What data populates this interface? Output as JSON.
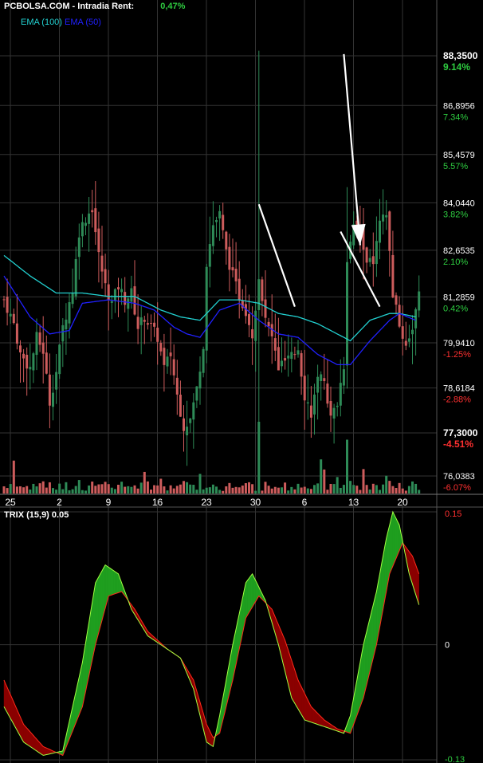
{
  "header": {
    "source": "PCBOLSA.COM",
    "mode": "Intradia",
    "rent_label": "Rent:",
    "rent_value": "0,47%"
  },
  "legend": {
    "ema100": {
      "label": "EMA (100)",
      "color": "#22d0d0"
    },
    "ema50": {
      "label": "EMA (50)",
      "color": "#2020ff"
    }
  },
  "colors": {
    "up": "#2e8b57",
    "down": "#cd5c5c",
    "pos_pct": "#2ecc40",
    "neg_pct": "#ff3030",
    "grid": "#333333"
  },
  "chart_data": [
    {
      "type": "candlestick",
      "ylim": [
        75.5,
        89.0
      ],
      "price_levels": [
        {
          "price": 88.35,
          "label": "88,3500",
          "pct": "9.14%",
          "positive": true,
          "bold": true
        },
        {
          "price": 86.8956,
          "label": "86,8956",
          "pct": "7.34%",
          "positive": true
        },
        {
          "price": 85.4579,
          "label": "85,4579",
          "pct": "5.57%",
          "positive": true
        },
        {
          "price": 84.044,
          "label": "84,0440",
          "pct": "3.82%",
          "positive": true
        },
        {
          "price": 82.6535,
          "label": "82,6535",
          "pct": "2.10%",
          "positive": true
        },
        {
          "price": 81.2859,
          "label": "81,2859",
          "pct": "0.42%",
          "positive": true
        },
        {
          "price": 79.941,
          "label": "79,9410",
          "pct": "-1.25%",
          "positive": false
        },
        {
          "price": 78.6184,
          "label": "78,6184",
          "pct": "-2.88%",
          "positive": false
        },
        {
          "price": 77.3,
          "label": "77,3000",
          "pct": "-4.51%",
          "positive": false,
          "bold": true
        },
        {
          "price": 76.0383,
          "label": "76,0383",
          "pct": "-6.07%",
          "positive": false
        }
      ],
      "x_ticks": [
        {
          "label": "25",
          "index": 0
        },
        {
          "label": "2",
          "index": 15
        },
        {
          "label": "9",
          "index": 30
        },
        {
          "label": "16",
          "index": 45
        },
        {
          "label": "23",
          "index": 60
        },
        {
          "label": "30",
          "index": 75
        },
        {
          "label": "6",
          "index": 90
        },
        {
          "label": "13",
          "index": 105
        },
        {
          "label": "20",
          "index": 120
        }
      ],
      "close_path": [
        [
          0,
          81.2
        ],
        [
          3,
          80.5
        ],
        [
          5,
          79.6
        ],
        [
          8,
          79.2
        ],
        [
          10,
          80.1
        ],
        [
          12,
          79.7
        ],
        [
          14,
          78.2
        ],
        [
          16,
          79.1
        ],
        [
          18,
          80.4
        ],
        [
          21,
          81.5
        ],
        [
          23,
          83.2
        ],
        [
          25,
          83.6
        ],
        [
          27,
          83.9
        ],
        [
          29,
          82.5
        ],
        [
          31,
          81.6
        ],
        [
          33,
          81.1
        ],
        [
          35,
          81.6
        ],
        [
          37,
          81.2
        ],
        [
          39,
          81.4
        ],
        [
          41,
          80.4
        ],
        [
          43,
          80.7
        ],
        [
          45,
          80.4
        ],
        [
          47,
          80.1
        ],
        [
          49,
          79.2
        ],
        [
          51,
          79.6
        ],
        [
          53,
          78.4
        ],
        [
          55,
          77.5
        ],
        [
          57,
          77.7
        ],
        [
          59,
          78.6
        ],
        [
          61,
          79.9
        ],
        [
          62,
          82.3
        ],
        [
          64,
          83.4
        ],
        [
          66,
          83.7
        ],
        [
          68,
          82.6
        ],
        [
          70,
          81.9
        ],
        [
          72,
          81.3
        ],
        [
          74,
          80.9
        ],
        [
          76,
          80.2
        ],
        [
          78,
          81.9
        ],
        [
          80,
          80.6
        ],
        [
          82,
          80.1
        ],
        [
          84,
          79.2
        ],
        [
          86,
          79.4
        ],
        [
          88,
          79.5
        ],
        [
          90,
          79.8
        ],
        [
          92,
          78.4
        ],
        [
          94,
          77.9
        ],
        [
          96,
          78.8
        ],
        [
          98,
          78.9
        ],
        [
          100,
          77.7
        ],
        [
          102,
          78.2
        ],
        [
          104,
          79.3
        ],
        [
          105,
          82.4
        ],
        [
          107,
          83.3
        ],
        [
          109,
          83.1
        ],
        [
          111,
          82.4
        ],
        [
          113,
          82.2
        ],
        [
          115,
          83.4
        ],
        [
          117,
          83.7
        ],
        [
          119,
          81.4
        ],
        [
          121,
          80.4
        ],
        [
          123,
          79.9
        ],
        [
          125,
          80.4
        ],
        [
          127,
          81.3
        ]
      ],
      "ema100": [
        [
          0,
          82.5
        ],
        [
          8,
          81.9
        ],
        [
          16,
          81.4
        ],
        [
          24,
          81.4
        ],
        [
          32,
          81.3
        ],
        [
          40,
          81.3
        ],
        [
          48,
          80.9
        ],
        [
          54,
          80.7
        ],
        [
          60,
          80.6
        ],
        [
          66,
          81.2
        ],
        [
          72,
          81.2
        ],
        [
          78,
          81.1
        ],
        [
          84,
          80.8
        ],
        [
          90,
          80.7
        ],
        [
          96,
          80.5
        ],
        [
          102,
          80.2
        ],
        [
          106,
          80.0
        ],
        [
          112,
          80.6
        ],
        [
          118,
          80.8
        ],
        [
          121,
          80.8
        ],
        [
          126,
          80.7
        ]
      ],
      "ema50": [
        [
          0,
          81.9
        ],
        [
          8,
          80.7
        ],
        [
          14,
          80.2
        ],
        [
          20,
          80.3
        ],
        [
          24,
          81.1
        ],
        [
          32,
          81.2
        ],
        [
          40,
          81.1
        ],
        [
          46,
          80.9
        ],
        [
          52,
          80.4
        ],
        [
          56,
          80.2
        ],
        [
          60,
          80.1
        ],
        [
          66,
          80.9
        ],
        [
          72,
          81.1
        ],
        [
          78,
          80.6
        ],
        [
          84,
          80.2
        ],
        [
          90,
          80.1
        ],
        [
          96,
          79.6
        ],
        [
          102,
          79.3
        ],
        [
          106,
          79.3
        ],
        [
          112,
          80.0
        ],
        [
          118,
          80.6
        ],
        [
          121,
          80.8
        ],
        [
          126,
          80.6
        ]
      ],
      "spikes": [
        {
          "index": 78,
          "high": 88.5,
          "low": 76.9
        },
        {
          "index": 105,
          "high": 84.5,
          "low": 78.6
        }
      ],
      "volume": {
        "typical_ratio": 0.18,
        "spikes": [
          {
            "index": 78,
            "ratio": 1.0
          },
          {
            "index": 105,
            "ratio": 0.75
          }
        ]
      },
      "annotations": [
        {
          "from": [
            78,
            84.0
          ],
          "to": [
            89,
            81.0
          ],
          "arrow": false
        },
        {
          "from": [
            104,
            88.4
          ],
          "to": [
            109,
            82.8
          ],
          "arrow": true
        },
        {
          "from": [
            103,
            83.2
          ],
          "to": [
            115,
            81.0
          ],
          "arrow": false
        }
      ]
    },
    {
      "type": "line",
      "label": "TRIX (15,9) 0.05",
      "ylim": [
        -0.13,
        0.15
      ],
      "y_labels": [
        {
          "value": 0.15,
          "label": "0.15",
          "color": "#ff3030"
        },
        {
          "value": 0,
          "label": "0",
          "color": "#ffffff"
        },
        {
          "value": -0.13,
          "label": "-0.13",
          "color": "#2ecc40"
        }
      ],
      "series": [
        {
          "name": "TRIX",
          "color": "#a0ff40",
          "points": [
            [
              0,
              -0.07
            ],
            [
              6,
              -0.11
            ],
            [
              12,
              -0.125
            ],
            [
              18,
              -0.12
            ],
            [
              24,
              -0.02
            ],
            [
              28,
              0.07
            ],
            [
              31,
              0.09
            ],
            [
              35,
              0.08
            ],
            [
              39,
              0.04
            ],
            [
              44,
              0.01
            ],
            [
              50,
              -0.005
            ],
            [
              54,
              -0.015
            ],
            [
              58,
              -0.05
            ],
            [
              62,
              -0.11
            ],
            [
              64,
              -0.115
            ],
            [
              66,
              -0.08
            ],
            [
              70,
              0.0
            ],
            [
              74,
              0.07
            ],
            [
              76,
              0.08
            ],
            [
              80,
              0.05
            ],
            [
              84,
              0.0
            ],
            [
              88,
              -0.06
            ],
            [
              92,
              -0.085
            ],
            [
              96,
              -0.09
            ],
            [
              100,
              -0.095
            ],
            [
              104,
              -0.1
            ],
            [
              106,
              -0.08
            ],
            [
              110,
              0.0
            ],
            [
              114,
              0.06
            ],
            [
              117,
              0.12
            ],
            [
              119,
              0.15
            ],
            [
              121,
              0.135
            ],
            [
              124,
              0.08
            ],
            [
              127,
              0.045
            ]
          ]
        },
        {
          "name": "Signal",
          "color": "#ff2a1a",
          "points": [
            [
              0,
              -0.04
            ],
            [
              6,
              -0.09
            ],
            [
              12,
              -0.115
            ],
            [
              18,
              -0.125
            ],
            [
              24,
              -0.07
            ],
            [
              28,
              0.0
            ],
            [
              32,
              0.055
            ],
            [
              36,
              0.06
            ],
            [
              40,
              0.04
            ],
            [
              44,
              0.015
            ],
            [
              50,
              -0.005
            ],
            [
              54,
              -0.015
            ],
            [
              58,
              -0.04
            ],
            [
              62,
              -0.09
            ],
            [
              64,
              -0.105
            ],
            [
              66,
              -0.1
            ],
            [
              70,
              -0.04
            ],
            [
              74,
              0.03
            ],
            [
              78,
              0.055
            ],
            [
              82,
              0.04
            ],
            [
              86,
              0.005
            ],
            [
              90,
              -0.04
            ],
            [
              94,
              -0.07
            ],
            [
              98,
              -0.085
            ],
            [
              102,
              -0.095
            ],
            [
              106,
              -0.1
            ],
            [
              110,
              -0.06
            ],
            [
              114,
              0.0
            ],
            [
              118,
              0.08
            ],
            [
              122,
              0.115
            ],
            [
              125,
              0.1
            ],
            [
              127,
              0.08
            ]
          ]
        }
      ]
    }
  ]
}
